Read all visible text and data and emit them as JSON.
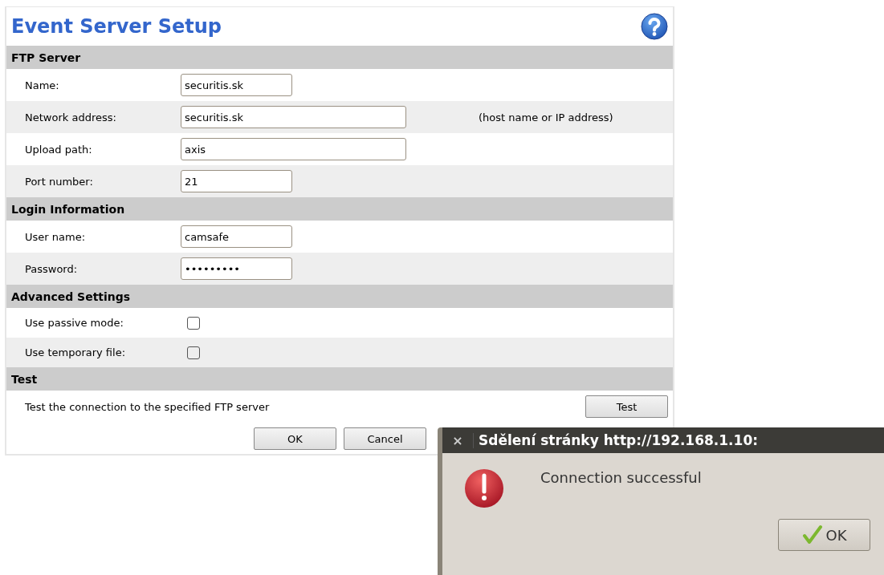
{
  "page": {
    "title": "Event Server Setup"
  },
  "sections": [
    {
      "title": "FTP Server",
      "rows": [
        {
          "kind": "text",
          "label": "Name:",
          "value": "securitis.sk"
        },
        {
          "kind": "wide-text",
          "label": "Network address:",
          "value": "securitis.sk",
          "hint": "(host name or IP address)"
        },
        {
          "kind": "wide-text",
          "label": "Upload path:",
          "value": "axis"
        },
        {
          "kind": "text",
          "label": "Port number:",
          "value": "21"
        }
      ]
    },
    {
      "title": "Login Information",
      "rows": [
        {
          "kind": "text",
          "label": "User name:",
          "value": "camsafe"
        },
        {
          "kind": "password",
          "label": "Password:",
          "value": "•••••••••"
        }
      ]
    },
    {
      "title": "Advanced Settings",
      "rows": [
        {
          "kind": "checkbox",
          "label": "Use passive mode:",
          "checked": false
        },
        {
          "kind": "checkbox",
          "label": "Use temporary file:",
          "checked": false
        }
      ]
    },
    {
      "title": "Test",
      "rows": [
        {
          "kind": "action",
          "label": "Test the connection to the specified FTP server",
          "button": "Test"
        }
      ]
    }
  ],
  "buttons": [
    "OK",
    "Cancel"
  ],
  "dialog": {
    "close": "×",
    "title": "Sdělení stránky http://192.168.1.10:",
    "message": "Connection successful",
    "button": "OK"
  }
}
